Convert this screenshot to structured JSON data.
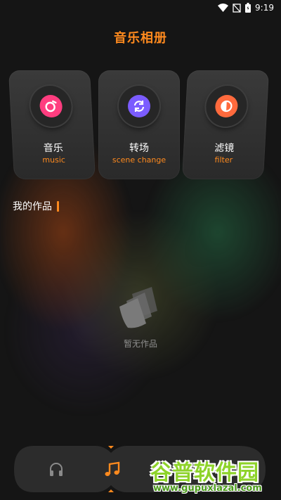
{
  "status_bar": {
    "time": "9:19",
    "icons": [
      "wifi-icon",
      "sim-icon",
      "battery-icon"
    ]
  },
  "app_title": "音乐相册",
  "cards": [
    {
      "label": "音乐",
      "sub": "music",
      "icon": "music-disc-icon",
      "color": "#ff3d7f"
    },
    {
      "label": "转场",
      "sub": "scene change",
      "icon": "refresh-icon",
      "color": "#7b5cff"
    },
    {
      "label": "滤镜",
      "sub": "filter",
      "icon": "filter-icon",
      "color": "#ff6a3d"
    }
  ],
  "section": {
    "title": "我的作品"
  },
  "empty_state": {
    "text": "暂无作品",
    "icon": "empty-box-icon"
  },
  "tab_bar": {
    "tabs": [
      {
        "icon": "headphones-icon",
        "active": false
      },
      {
        "icon": "music-note-icon",
        "active": true
      },
      {
        "icon": "profile-icon",
        "active": false
      }
    ]
  },
  "watermark": {
    "title": "谷普软件园",
    "url": "www.gupuxlazal.com"
  },
  "colors": {
    "accent": "#ff8a1e",
    "background": "#151515",
    "card": "#333333"
  }
}
